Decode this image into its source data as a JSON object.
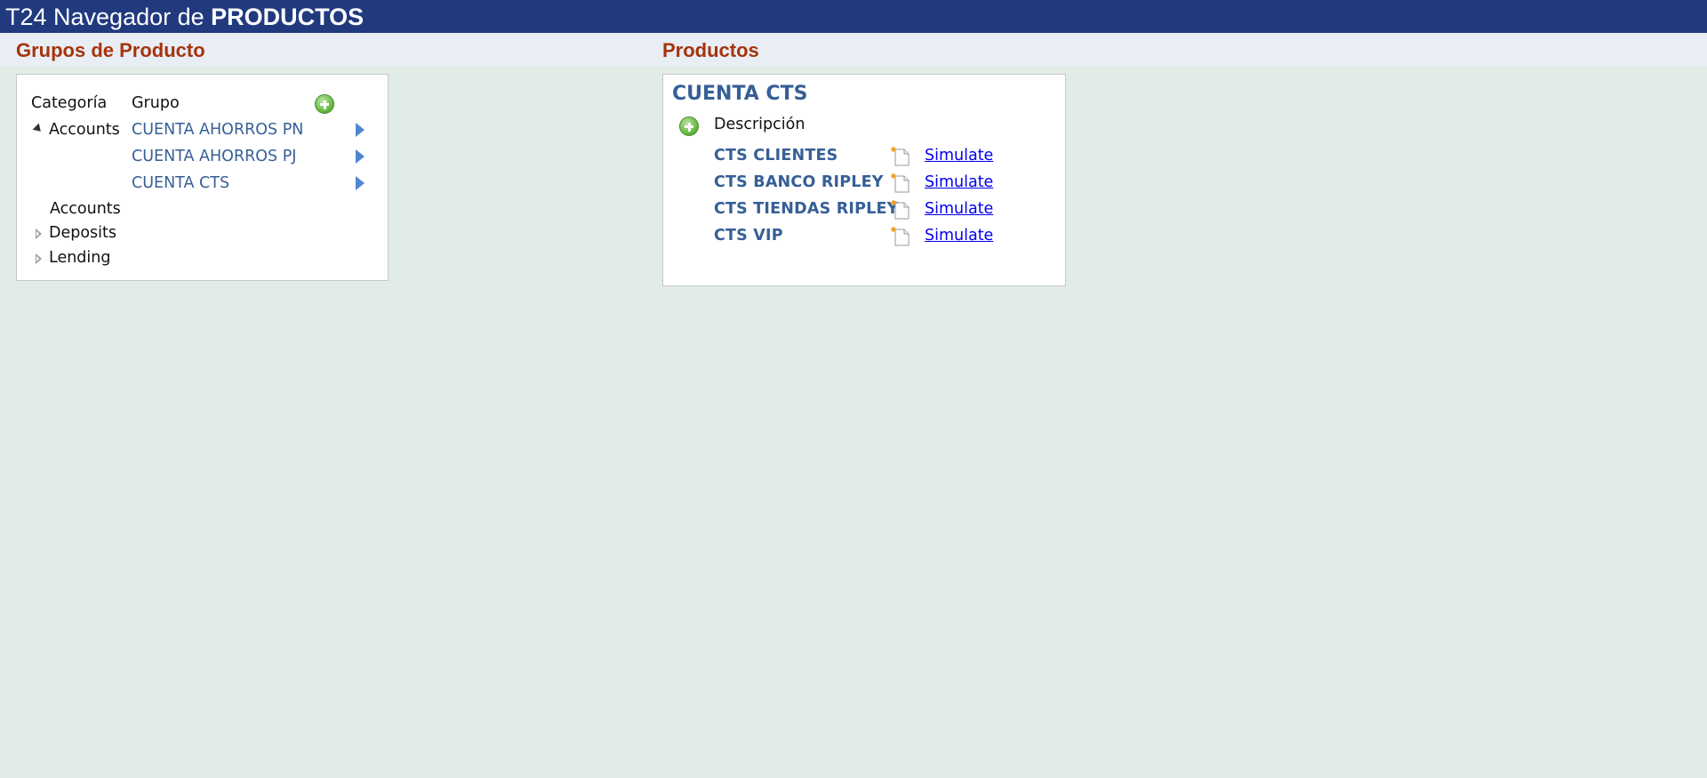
{
  "header": {
    "title_prefix": "T24 Navegador de ",
    "title_strong": "PRODUCTOS"
  },
  "groups_section": {
    "title": "Grupos de Producto",
    "col_category": "Categoría",
    "col_group": "Grupo",
    "add_icon": "add-circle-icon",
    "categories": [
      {
        "label": "Accounts",
        "state": "expanded"
      },
      {
        "label": "Deposits",
        "state": "collapsed"
      },
      {
        "label": "Lending",
        "state": "collapsed"
      }
    ],
    "groups": [
      {
        "label": "CUENTA AHORROS PN"
      },
      {
        "label": "CUENTA AHORROS PJ"
      },
      {
        "label": "CUENTA CTS"
      }
    ],
    "sub_label": "Accounts"
  },
  "products_section": {
    "title": "Productos",
    "group_title": "CUENTA CTS",
    "col_description": "Descripción",
    "add_icon": "add-circle-icon",
    "items": [
      {
        "name": "CTS CLIENTES",
        "action": "Simulate"
      },
      {
        "name": "CTS BANCO RIPLEY",
        "action": "Simulate"
      },
      {
        "name": "CTS TIENDAS RIPLEY",
        "action": "Simulate"
      },
      {
        "name": "CTS VIP",
        "action": "Simulate"
      }
    ]
  },
  "colors": {
    "title_bar": "#213a7e",
    "section_title": "#a5340d",
    "link_blue": "#365f96",
    "background": "#e1ebe8"
  }
}
